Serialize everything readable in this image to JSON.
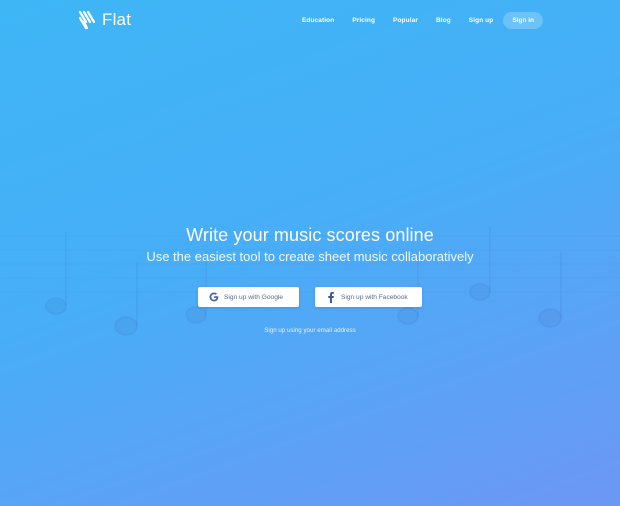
{
  "brand": {
    "name": "Flat",
    "logo_icon": "flat-stripes-logo-icon"
  },
  "nav": {
    "links": [
      "Education",
      "Pricing",
      "Popular",
      "Blog",
      "Sign up"
    ],
    "signin_label": "Sign in"
  },
  "hero": {
    "title": "Write your music scores online",
    "subtitle": "Use the easiest tool to create sheet music collaboratively"
  },
  "buttons": {
    "google": {
      "label": "Sign up with Google",
      "icon": "google-icon"
    },
    "facebook": {
      "label": "Sign up with Facebook",
      "icon": "facebook-icon"
    }
  },
  "email_link": "Sign up using your email address",
  "colors": {
    "gradient_start": "#3eb6f6",
    "gradient_end": "#6d97f5",
    "button_text": "#5b6b8a"
  }
}
